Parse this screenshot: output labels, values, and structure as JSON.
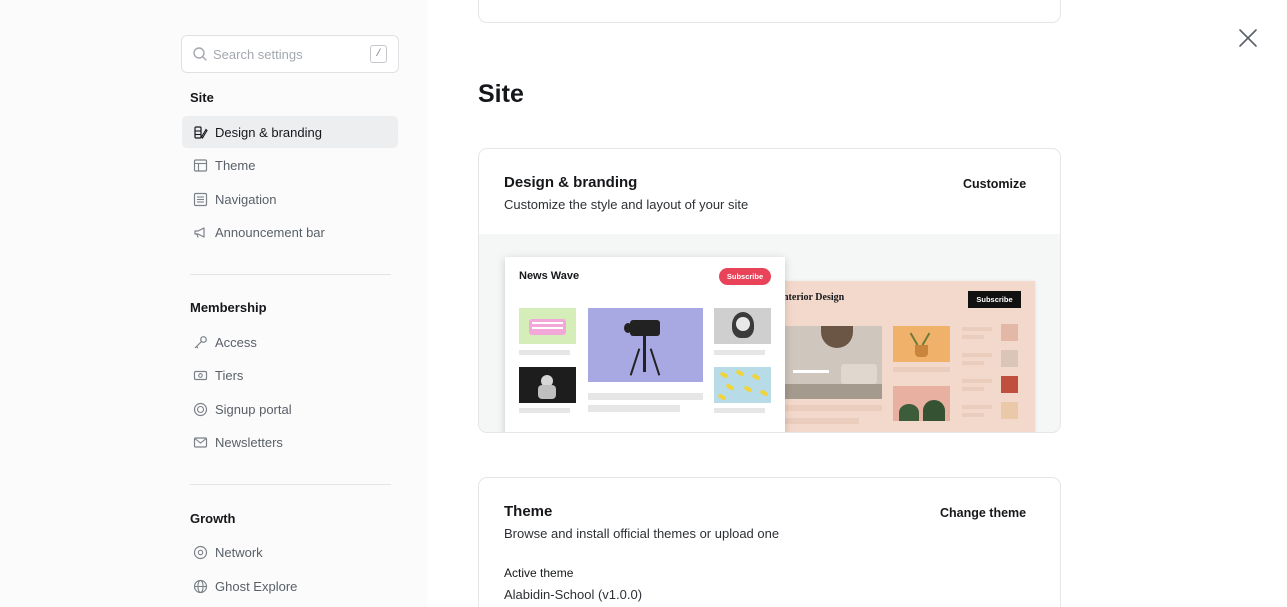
{
  "sidebar": {
    "search": {
      "placeholder": "Search settings",
      "shortcut": "/"
    },
    "groups": [
      {
        "title": "Site",
        "items": [
          {
            "label": "Design & branding",
            "icon": "brush-icon",
            "active": true
          },
          {
            "label": "Theme",
            "icon": "layout-icon"
          },
          {
            "label": "Navigation",
            "icon": "list-icon"
          },
          {
            "label": "Announcement bar",
            "icon": "megaphone-icon"
          }
        ]
      },
      {
        "title": "Membership",
        "items": [
          {
            "label": "Access",
            "icon": "key-icon"
          },
          {
            "label": "Tiers",
            "icon": "ticket-icon"
          },
          {
            "label": "Signup portal",
            "icon": "portal-icon"
          },
          {
            "label": "Newsletters",
            "icon": "mail-icon"
          }
        ]
      },
      {
        "title": "Growth",
        "items": [
          {
            "label": "Network",
            "icon": "network-icon"
          },
          {
            "label": "Ghost Explore",
            "icon": "globe-icon"
          }
        ]
      }
    ]
  },
  "main": {
    "section_title": "Site",
    "design_card": {
      "title": "Design & branding",
      "description": "Customize the style and layout of your site",
      "action": "Customize",
      "preview": {
        "left_brand": "News Wave",
        "left_subscribe": "Subscribe",
        "right_brand": "nterior Design",
        "right_subscribe": "Subscribe"
      }
    },
    "theme_card": {
      "title": "Theme",
      "description": "Browse and install official themes or upload one",
      "action": "Change theme",
      "active_theme_label": "Active theme",
      "active_theme_value": "Alabidin-School (v1.0.0)"
    }
  },
  "colors": {
    "sidebar_bg": "#fbfbfb",
    "active_item_bg": "#eceef0",
    "subscribe_red": "#e9435a",
    "interior_bg": "#f3d9cb"
  }
}
